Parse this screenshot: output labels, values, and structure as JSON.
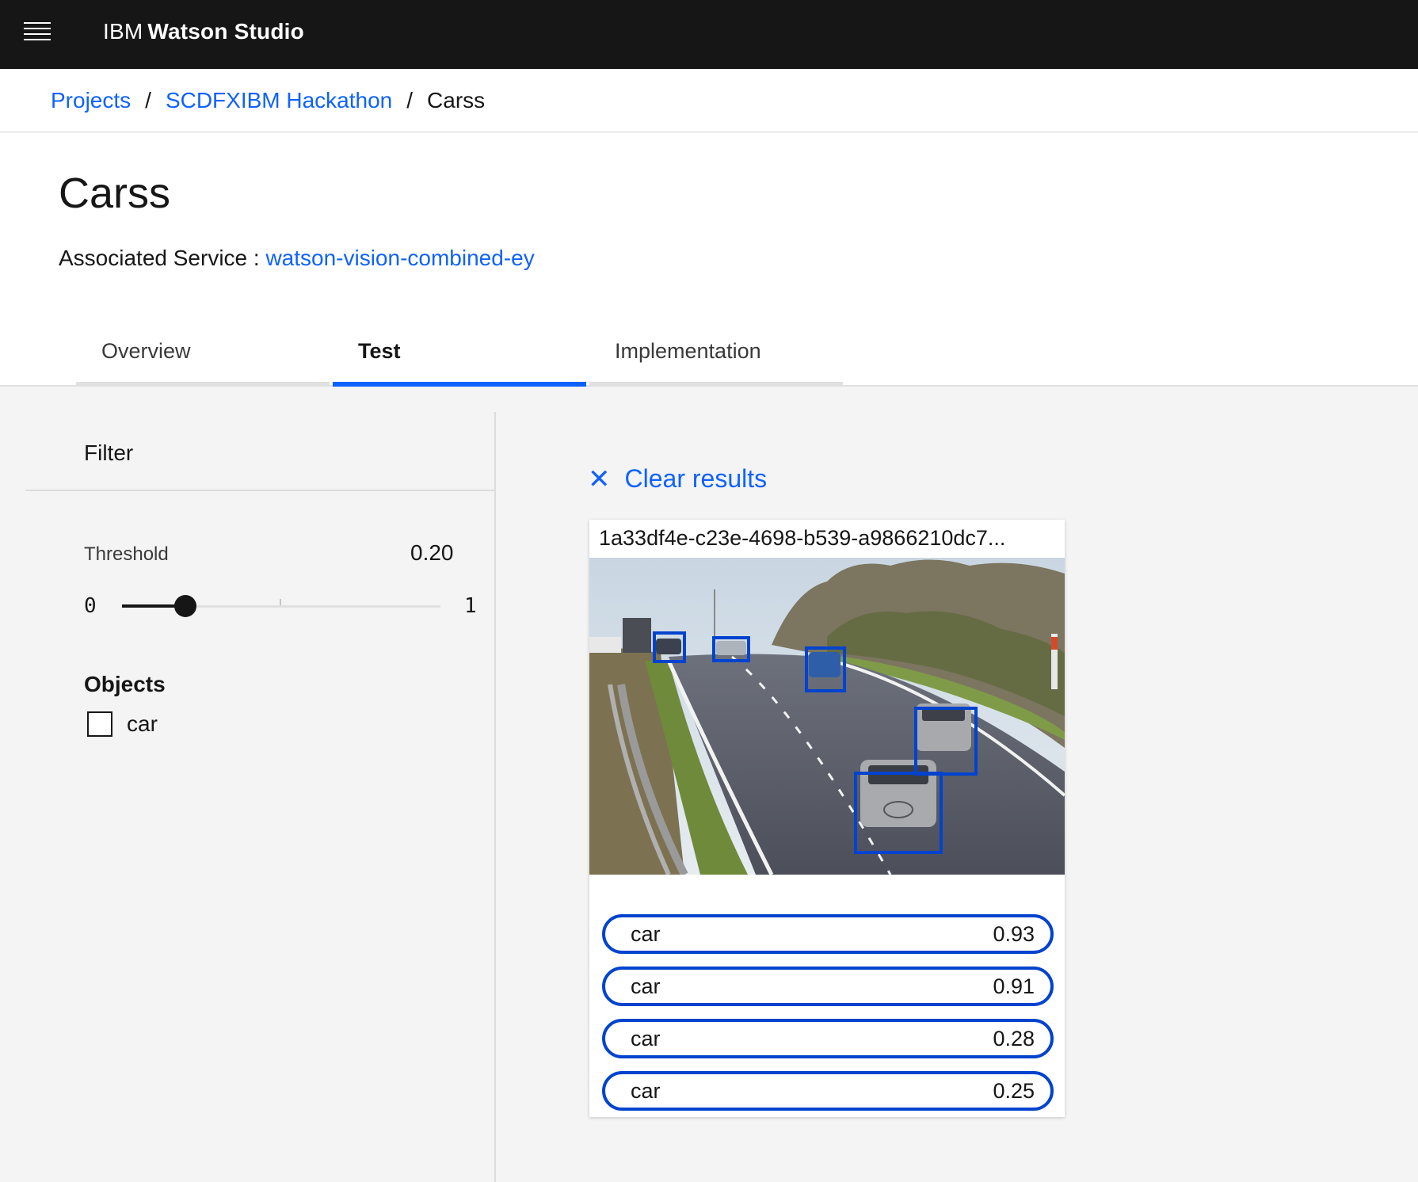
{
  "header": {
    "brand_prefix": "IBM",
    "brand_name": "Watson Studio"
  },
  "breadcrumb": {
    "items": [
      "Projects",
      "SCDFXIBM Hackathon"
    ],
    "current": "Carss"
  },
  "page": {
    "title": "Carss",
    "service_label": "Associated Service :",
    "service_link": "watson-vision-combined-ey"
  },
  "tabs": [
    {
      "label": "Overview",
      "active": false
    },
    {
      "label": "Test",
      "active": true
    },
    {
      "label": "Implementation",
      "active": false
    }
  ],
  "filter": {
    "title": "Filter",
    "threshold_label": "Threshold",
    "threshold_value": "0.20",
    "threshold_fraction": 0.2,
    "slider_min": "0",
    "slider_max": "1",
    "objects_title": "Objects",
    "objects": [
      {
        "label": "car",
        "checked": false
      }
    ]
  },
  "results": {
    "clear_label": "Clear results",
    "image_name": "1a33df4e-c23e-4698-b539-a9866210dc7...",
    "detections": [
      {
        "label": "car",
        "score": "0.93"
      },
      {
        "label": "car",
        "score": "0.91"
      },
      {
        "label": "car",
        "score": "0.28"
      },
      {
        "label": "car",
        "score": "0.25"
      }
    ]
  },
  "colors": {
    "accent": "#0f62fe",
    "box_blue": "#0043ce",
    "topbar": "#161616"
  }
}
